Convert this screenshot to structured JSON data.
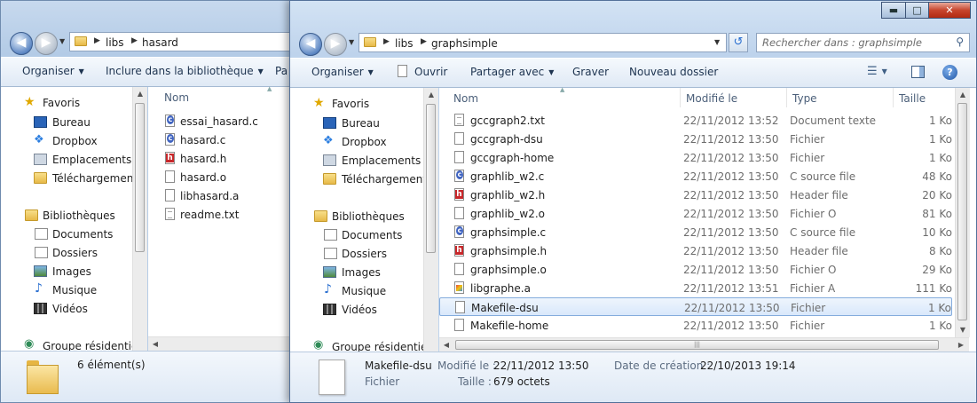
{
  "back_window": {
    "breadcrumb": [
      "libs",
      "hasard"
    ],
    "toolbar": {
      "organize": "Organiser",
      "include": "Inclure dans la bibliothèque",
      "share_partial": "Pa"
    },
    "nav": {
      "favorites": "Favoris",
      "items": [
        "Bureau",
        "Dropbox",
        "Emplacements ré",
        "Téléchargements"
      ],
      "libraries": "Bibliothèques",
      "lib_items": [
        "Documents",
        "Dossiers",
        "Images",
        "Musique",
        "Vidéos"
      ],
      "homegroup": "Groupe résidentiel"
    },
    "column_name": "Nom",
    "files": [
      {
        "name": "essai_hasard.c",
        "icon": "c-source-icon"
      },
      {
        "name": "hasard.c",
        "icon": "c-source-icon"
      },
      {
        "name": "hasard.h",
        "icon": "header-icon"
      },
      {
        "name": "hasard.o",
        "icon": "generic-file-icon"
      },
      {
        "name": "libhasard.a",
        "icon": "generic-file-icon"
      },
      {
        "name": "readme.txt",
        "icon": "text-file-icon"
      }
    ],
    "status": "6 élément(s)"
  },
  "front_window": {
    "breadcrumb": [
      "libs",
      "graphsimple"
    ],
    "search_placeholder": "Rechercher dans : graphsimple",
    "toolbar": {
      "organize": "Organiser",
      "open": "Ouvrir",
      "share": "Partager avec",
      "burn": "Graver",
      "new_folder": "Nouveau dossier"
    },
    "nav": {
      "favorites": "Favoris",
      "items": [
        "Bureau",
        "Dropbox",
        "Emplacements ré",
        "Téléchargements"
      ],
      "libraries": "Bibliothèques",
      "lib_items": [
        "Documents",
        "Dossiers",
        "Images",
        "Musique",
        "Vidéos"
      ],
      "homegroup": "Groupe résidentiel"
    },
    "columns": {
      "name": "Nom",
      "modified": "Modifié le",
      "type": "Type",
      "size": "Taille"
    },
    "files": [
      {
        "name": "gccgraph2.txt",
        "modified": "22/11/2012 13:52",
        "type": "Document texte",
        "size": "1 Ko",
        "icon": "text-file-icon"
      },
      {
        "name": "gccgraph-dsu",
        "modified": "22/11/2012 13:50",
        "type": "Fichier",
        "size": "1 Ko",
        "icon": "generic-file-icon"
      },
      {
        "name": "gccgraph-home",
        "modified": "22/11/2012 13:50",
        "type": "Fichier",
        "size": "1 Ko",
        "icon": "generic-file-icon"
      },
      {
        "name": "graphlib_w2.c",
        "modified": "22/11/2012 13:50",
        "type": "C source file",
        "size": "48 Ko",
        "icon": "c-source-icon"
      },
      {
        "name": "graphlib_w2.h",
        "modified": "22/11/2012 13:50",
        "type": "Header file",
        "size": "20 Ko",
        "icon": "header-icon"
      },
      {
        "name": "graphlib_w2.o",
        "modified": "22/11/2012 13:50",
        "type": "Fichier O",
        "size": "81 Ko",
        "icon": "generic-file-icon"
      },
      {
        "name": "graphsimple.c",
        "modified": "22/11/2012 13:50",
        "type": "C source file",
        "size": "10 Ko",
        "icon": "c-source-icon"
      },
      {
        "name": "graphsimple.h",
        "modified": "22/11/2012 13:50",
        "type": "Header file",
        "size": "8 Ko",
        "icon": "header-icon"
      },
      {
        "name": "graphsimple.o",
        "modified": "22/11/2012 13:50",
        "type": "Fichier O",
        "size": "29 Ko",
        "icon": "generic-file-icon"
      },
      {
        "name": "libgraphe.a",
        "modified": "22/11/2012 13:51",
        "type": "Fichier A",
        "size": "111 Ko",
        "icon": "archive-icon"
      },
      {
        "name": "Makefile-dsu",
        "modified": "22/11/2012 13:50",
        "type": "Fichier",
        "size": "1 Ko",
        "icon": "generic-file-icon",
        "selected": true
      },
      {
        "name": "Makefile-home",
        "modified": "22/11/2012 13:50",
        "type": "Fichier",
        "size": "1 Ko",
        "icon": "generic-file-icon"
      }
    ],
    "details": {
      "filename": "Makefile-dsu",
      "filetype": "Fichier",
      "modified_label": "Modifié le :",
      "modified_value": "22/11/2012 13:50",
      "created_label": "Date de création :",
      "created_value": "22/10/2013 19:14",
      "size_label": "Taille :",
      "size_value": "679 octets"
    }
  }
}
